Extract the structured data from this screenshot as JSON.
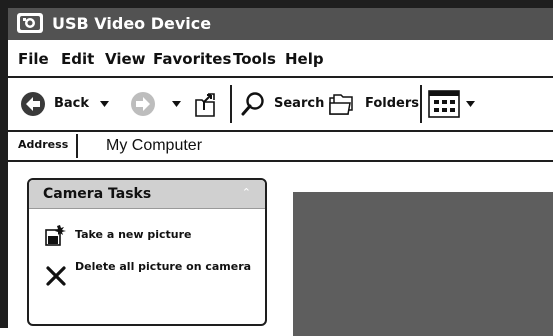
{
  "window": {
    "title": "USB Video Device"
  },
  "menu": [
    "File",
    "Edit",
    "View",
    "Favorites",
    "Tools",
    "Help"
  ],
  "toolbar": {
    "back_label": "Back",
    "search_label": "Search",
    "folders_label": "Folders"
  },
  "address": {
    "label": "Address",
    "value": "My Computer"
  },
  "tasks": {
    "title": "Camera Tasks",
    "items": [
      {
        "label": "Take a new picture",
        "icon": "camera-flash-icon"
      },
      {
        "label": "Delete all picture on camera",
        "icon": "delete-x-icon"
      }
    ]
  },
  "colors": {
    "titlebar": "#525252",
    "border": "#1e1e1e",
    "panel_header": "#d0d0d0",
    "preview": "#5e5e5e"
  }
}
